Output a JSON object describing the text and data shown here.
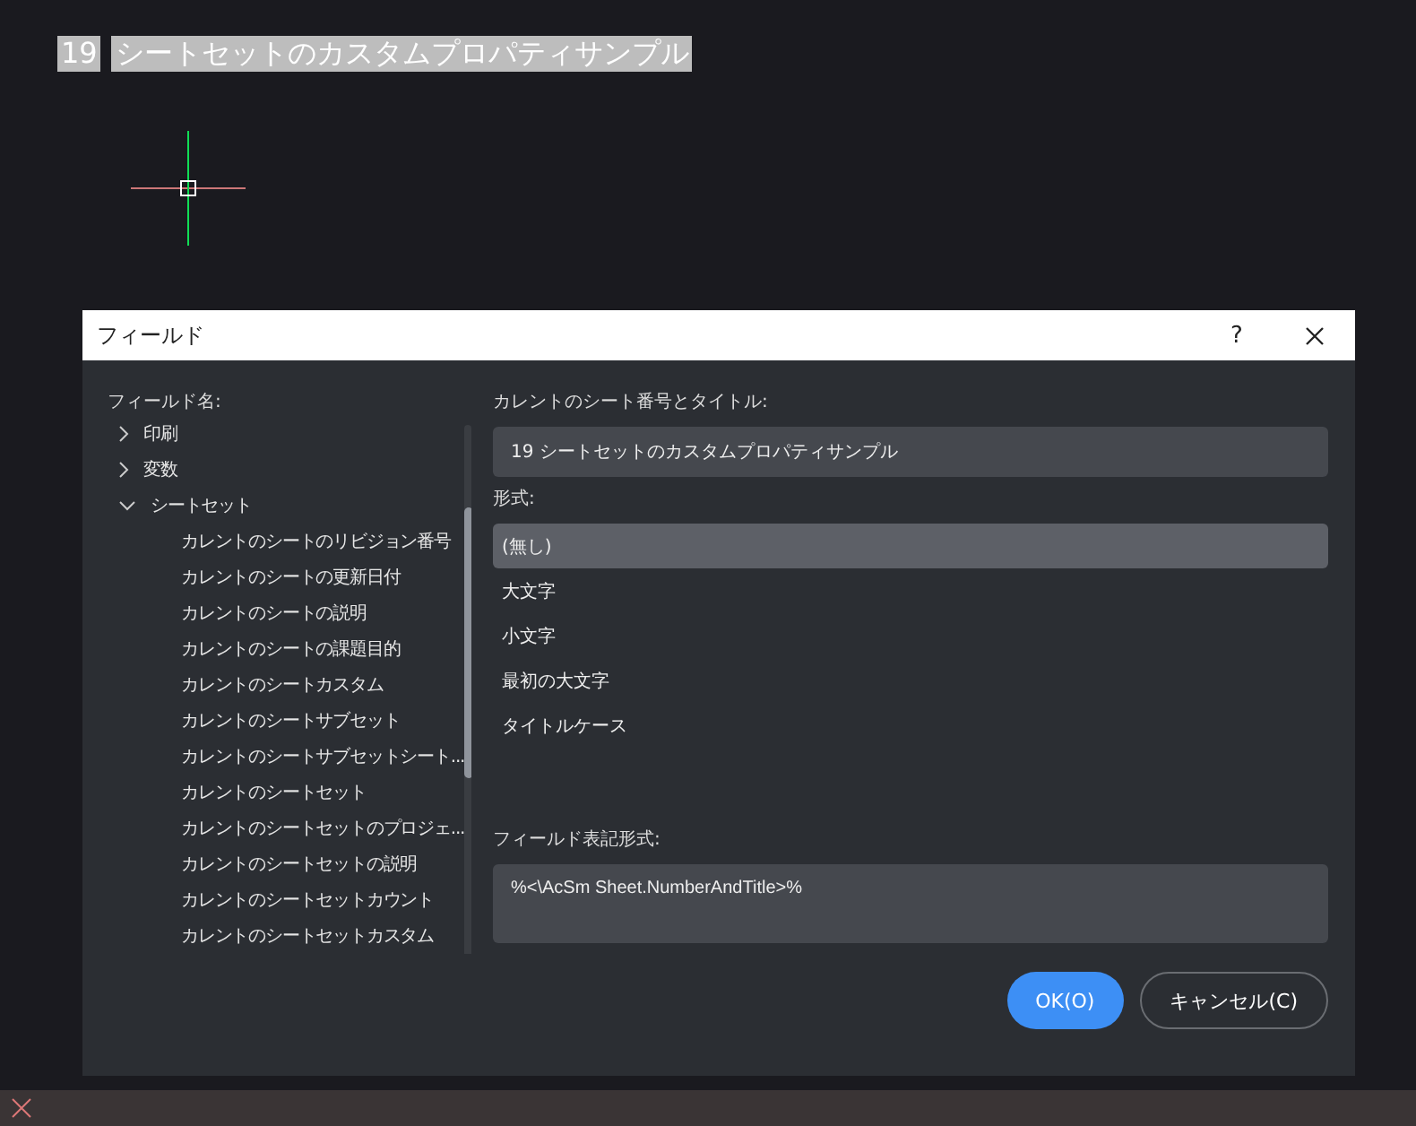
{
  "drawing": {
    "sheet_number": "19",
    "sheet_title": "シートセットのカスタムプロパティサンプル"
  },
  "dialog": {
    "title": "フィールド",
    "help": "?",
    "field_names": {
      "label": "フィールド名:",
      "tree": [
        {
          "label": "印刷",
          "expanded": false
        },
        {
          "label": "変数",
          "expanded": false
        },
        {
          "label": "シートセット",
          "expanded": true,
          "children": [
            {
              "label": "カレントのシートのリビジョン番号"
            },
            {
              "label": "カレントのシートの更新日付"
            },
            {
              "label": "カレントのシートの説明"
            },
            {
              "label": "カレントのシートの課題目的"
            },
            {
              "label": "カレントのシートカスタム"
            },
            {
              "label": "カレントのシートサブセット"
            },
            {
              "label": "カレントのシートサブセットシート..."
            },
            {
              "label": "カレントのシートセット"
            },
            {
              "label": "カレントのシートセットのプロジェ..."
            },
            {
              "label": "カレントのシートセットの説明"
            },
            {
              "label": "カレントのシートセットカウント"
            },
            {
              "label": "カレントのシートセットカスタム"
            }
          ]
        }
      ]
    },
    "value": {
      "label": "カレントのシート番号とタイトル:",
      "text": "19 シートセットのカスタムプロパティサンプル"
    },
    "format": {
      "label": "形式:",
      "options": [
        {
          "label": "(無し)",
          "selected": true
        },
        {
          "label": "大文字",
          "selected": false
        },
        {
          "label": "小文字",
          "selected": false
        },
        {
          "label": "最初の大文字",
          "selected": false
        },
        {
          "label": "タイトルケース",
          "selected": false
        }
      ]
    },
    "expression": {
      "label": "フィールド表記形式:",
      "text": "%<\\AcSm Sheet.NumberAndTitle>%"
    },
    "buttons": [
      {
        "label": "OK(O)",
        "kind": "primary"
      },
      {
        "label": "キャンセル(C)",
        "kind": "secondary"
      }
    ]
  }
}
